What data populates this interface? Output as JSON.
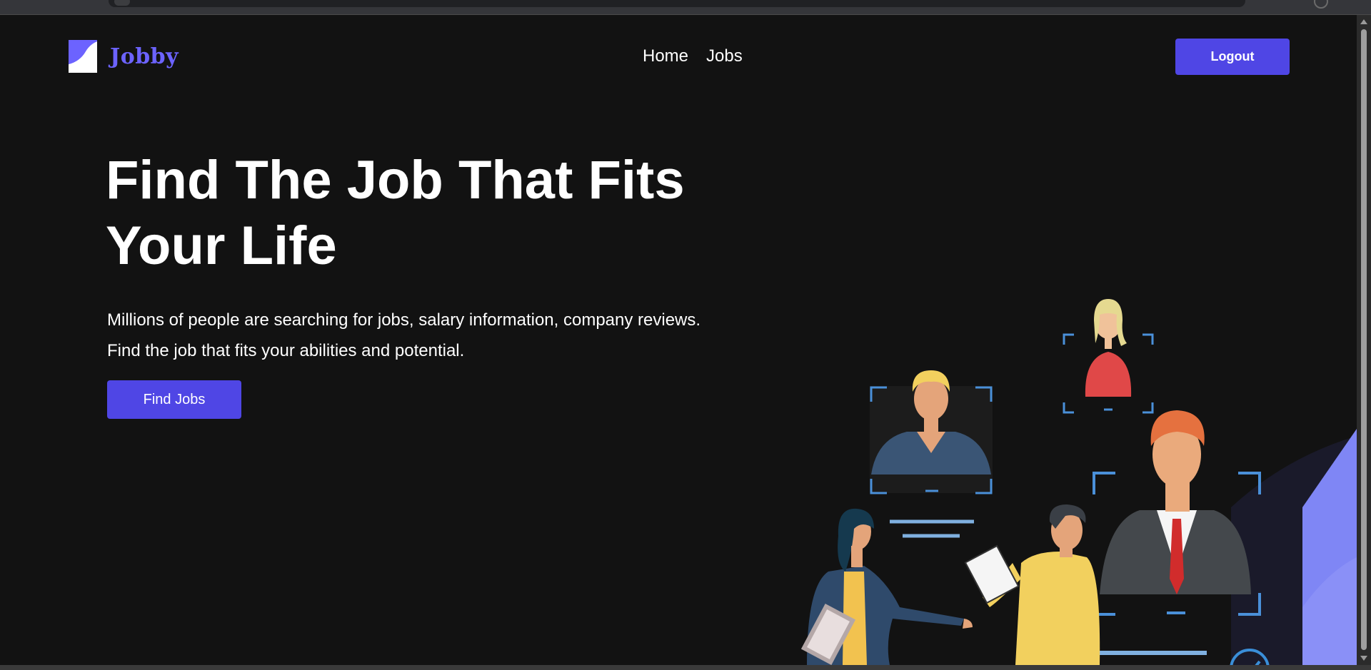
{
  "app": {
    "name": "Jobby"
  },
  "nav": {
    "home": "Home",
    "jobs": "Jobs"
  },
  "header": {
    "logout_label": "Logout"
  },
  "hero": {
    "title_line1": "Find The Job That Fits",
    "title_line2": "Your Life",
    "desc_line1": "Millions of people are searching for jobs, salary information, company reviews.",
    "desc_line2": "Find the job that fits your abilities and potential.",
    "cta_label": "Find Jobs"
  },
  "colors": {
    "background": "#121212",
    "accent": "#4f46e5",
    "logo_text": "#6c63ff",
    "text": "#ffffff",
    "frame_blue": "#4a90d9",
    "shape_purple": "#7f86f5"
  },
  "icons": [
    "logo-icon",
    "people-illustration",
    "checkmark-icon"
  ]
}
